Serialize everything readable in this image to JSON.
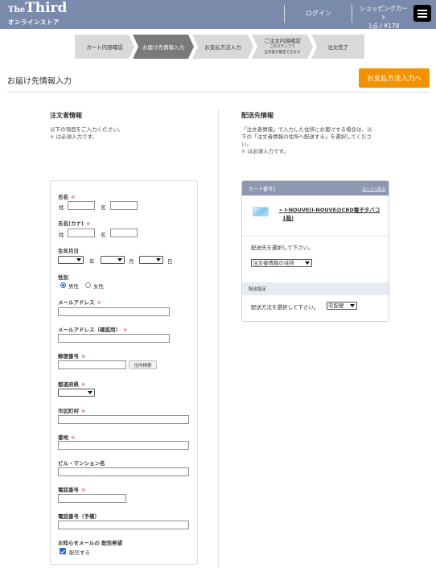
{
  "header": {
    "logo_line1_small": "The",
    "logo_line1_big": "Third",
    "logo_line2": "オンラインストア",
    "login_label": "ログイン",
    "cart_label": "ショッピングカート",
    "cart_summary": "1点 / ¥178",
    "menu_icon": "hamburger-menu-icon"
  },
  "steps": [
    {
      "label": "カート内容確認",
      "active": false
    },
    {
      "label": "お届け先情報入力",
      "active": true
    },
    {
      "label": "お支払方法入力",
      "active": false
    },
    {
      "label": "ご注文内容確認",
      "note1": "このステップで",
      "note2": "全内容が確定できます",
      "active": false
    },
    {
      "label": "注文完了",
      "active": false
    }
  ],
  "page": {
    "title": "お届け先情報入力",
    "next_button": "お支払方法入力へ"
  },
  "left": {
    "title": "注文者情報",
    "intro": "以下の項目をご入力ください。",
    "required_mark": "※",
    "required_note": "は必須入力です。"
  },
  "form": {
    "name_label": "氏名",
    "kana_label": "氏名(カナ)",
    "sei": "姓",
    "mei": "名",
    "birth_label": "生年月日",
    "year": "年",
    "month": "月",
    "day": "日",
    "gender_label": "性別",
    "gender_male": "男性",
    "gender_female": "女性",
    "gender_selected": "男性",
    "email_label": "メールアドレス",
    "email_confirm_label": "メールアドレス（確認用）",
    "zip_label": "郵便番号",
    "address_search": "住所検索",
    "pref_label": "都道府県",
    "city_label": "市区町村",
    "street_label": "番地",
    "building_label": "ビル・マンション名",
    "phone_label": "電話番号",
    "mobile_label": "電話番号（予備）",
    "newsletter_label": "お知らせメールの 配信希望",
    "newsletter_option": "配信する",
    "newsletter_checked": true,
    "req": "※"
  },
  "right": {
    "title": "配送先情報",
    "intro_line1": "「注文者情報」で入力した住所にお届けする場合は、以",
    "intro_line2": "下の「注文者情報の住所へ配送する」を選択してくださ",
    "intro_line3": "い。",
    "required_mark": "※",
    "required_note": "は必須入力です。",
    "cart_no": "カート番号1",
    "cart_back": "カートへ戻る",
    "product_line1": "» I-NOUVE(I-NOUVEのCBD電子タバコ",
    "product_line2": "1箱)",
    "choose_dest": "配送先を選択して下さい。",
    "dest_value": "注文者情報の住所",
    "delivery_header": "配送指定",
    "choose_method": "配送方法を選択して下さい。",
    "method_value": "宅配便"
  }
}
